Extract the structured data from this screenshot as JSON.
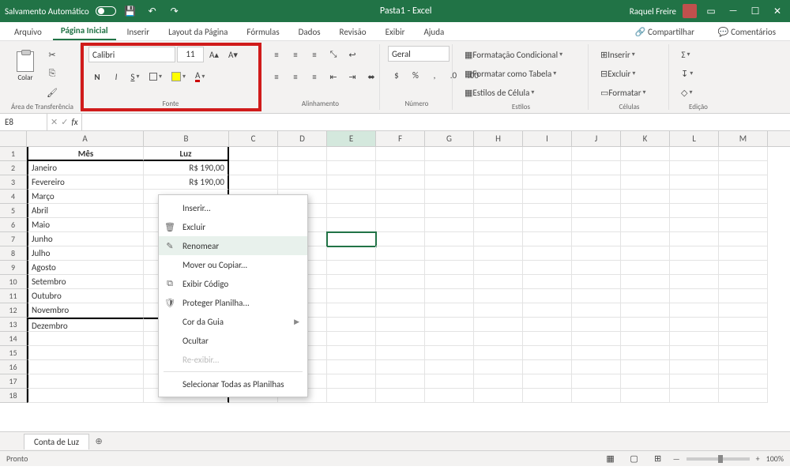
{
  "titlebar": {
    "autosave_label": "Salvamento Automático",
    "doc_title": "Pasta1 - Excel",
    "user_name": "Raquel Freire"
  },
  "tabs": {
    "arquivo": "Arquivo",
    "pagina_inicial": "Página Inicial",
    "inserir": "Inserir",
    "layout": "Layout da Página",
    "formulas": "Fórmulas",
    "dados": "Dados",
    "revisao": "Revisão",
    "exibir": "Exibir",
    "ajuda": "Ajuda",
    "compartilhar": "Compartilhar",
    "comentarios": "Comentários"
  },
  "ribbon": {
    "clipboard": {
      "label": "Área de Transferência",
      "paste": "Colar"
    },
    "font": {
      "label": "Fonte",
      "name": "Calibri",
      "size": "11",
      "bold": "N",
      "italic": "I",
      "underline": "S"
    },
    "alignment": {
      "label": "Alinhamento"
    },
    "number": {
      "label": "Número",
      "format": "Geral"
    },
    "styles": {
      "label": "Estilos",
      "cond": "Formatação Condicional",
      "table": "Formatar como Tabela",
      "cell": "Estilos de Célula"
    },
    "cells": {
      "label": "Células",
      "insert": "Inserir",
      "delete": "Excluir",
      "format": "Formatar"
    },
    "editing": {
      "label": "Edição"
    }
  },
  "namebox": "E8",
  "columns": [
    "A",
    "B",
    "C",
    "D",
    "E",
    "F",
    "G",
    "H",
    "I",
    "J",
    "K",
    "L",
    "M"
  ],
  "headers": {
    "A": "Mês",
    "B": "Luz"
  },
  "data_rows": [
    {
      "n": "1"
    },
    {
      "n": "2",
      "A": "Janeiro",
      "B": "R$    190,00"
    },
    {
      "n": "3",
      "A": "Fevereiro",
      "B": "R$    190,00"
    },
    {
      "n": "4",
      "A": "Março"
    },
    {
      "n": "5",
      "A": "Abril"
    },
    {
      "n": "6",
      "A": "Maio"
    },
    {
      "n": "7",
      "A": "Junho"
    },
    {
      "n": "8",
      "A": "Julho"
    },
    {
      "n": "9",
      "A": "Agosto"
    },
    {
      "n": "10",
      "A": "Setembro"
    },
    {
      "n": "11",
      "A": "Outubro"
    },
    {
      "n": "12",
      "A": "Novembro"
    },
    {
      "n": "13",
      "A": "Dezembro"
    },
    {
      "n": "14"
    },
    {
      "n": "15"
    },
    {
      "n": "16"
    },
    {
      "n": "17"
    },
    {
      "n": "18"
    }
  ],
  "context_menu": {
    "inserir": "Inserir...",
    "excluir": "Excluir",
    "renomear": "Renomear",
    "mover": "Mover ou Copiar...",
    "codigo": "Exibir Código",
    "proteger": "Proteger Planilha...",
    "cor": "Cor da Guia",
    "ocultar": "Ocultar",
    "reexibir": "Re-exibir...",
    "todas": "Selecionar Todas as Planilhas"
  },
  "sheet_tab": "Conta de Luz",
  "status": {
    "ready": "Pronto",
    "zoom": "100%"
  }
}
